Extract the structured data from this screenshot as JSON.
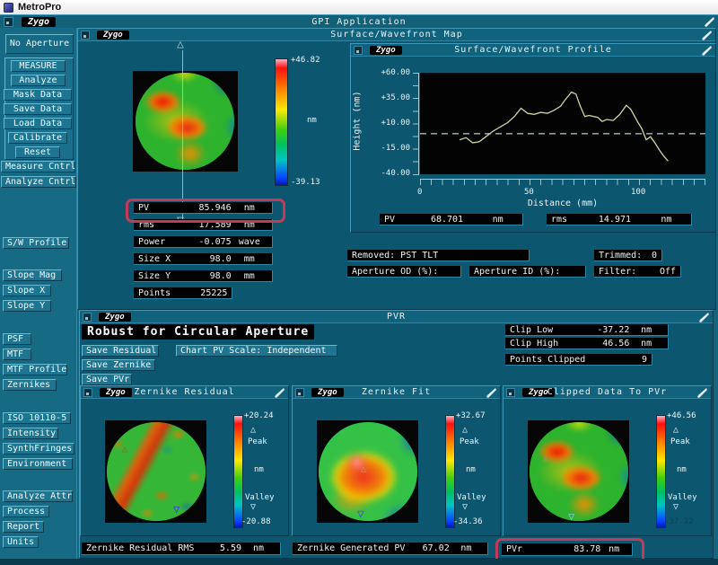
{
  "brand": "Zygo",
  "window": {
    "title": "MetroPro"
  },
  "app_bar": {
    "title": "GPI Application"
  },
  "sidebar": {
    "aperture_label": "No Aperture",
    "measure_group": [
      "MEASURE",
      "Analyze",
      "Mask Data",
      "Save Data",
      "Load Data",
      "Calibrate",
      "Reset"
    ],
    "cntrl": [
      "Measure Cntrl",
      "Analyze Cntrl"
    ],
    "profile": "S/W Profile",
    "slope": [
      "Slope Mag",
      "Slope X",
      "Slope Y"
    ],
    "optics": [
      "PSF",
      "MTF",
      "MTF Profile",
      "Zernikes"
    ],
    "iso": [
      "ISO 10110-5",
      "Intensity",
      "SynthFringes",
      "Environment"
    ],
    "misc": [
      "Analyze Attr",
      "Process",
      "Report",
      "Units"
    ]
  },
  "map_panel": {
    "title": "Surface/Wavefront Map",
    "colorbar": {
      "max": "+46.82",
      "unit": "nm",
      "min": "-39.13"
    },
    "stats": [
      {
        "label": "PV",
        "value": "85.946",
        "unit": "nm"
      },
      {
        "label": "rms",
        "value": "17.589",
        "unit": "nm"
      },
      {
        "label": "Power",
        "value": "-0.075",
        "unit": "wave"
      },
      {
        "label": "Size X",
        "value": "98.0",
        "unit": "mm"
      },
      {
        "label": "Size Y",
        "value": "98.0",
        "unit": "mm"
      },
      {
        "label": "Points",
        "value": "25225",
        "unit": ""
      }
    ]
  },
  "profile_panel": {
    "title": "Surface/Wavefront Profile",
    "ylabel": "Height (nm)",
    "xlabel": "Distance (mm)",
    "yticks": [
      "+60.00",
      "+35.00",
      "+10.00",
      "-15.00",
      "-40.00"
    ],
    "xticks": [
      "0",
      "50",
      "100"
    ],
    "stats": [
      {
        "label": "PV",
        "value": "68.701",
        "unit": "nm"
      },
      {
        "label": "rms",
        "value": "14.971",
        "unit": "nm"
      }
    ]
  },
  "attributes": {
    "removed": "Removed: PST TLT",
    "trimmed_label": "Trimmed:",
    "trimmed_value": "0",
    "aperture_od": "Aperture OD (%):",
    "aperture_id": "Aperture ID (%):",
    "filter_label": "Filter:",
    "filter_value": "Off"
  },
  "pvr_panel": {
    "title": "PVR",
    "heading": "Robust for Circular Aperture",
    "save_residual": "Save Residual",
    "chart_scale": "Chart PV Scale: Independent",
    "save_zernike": "Save Zernike",
    "save_pvr": "Save PVr",
    "clip_stats": [
      {
        "label": "Clip Low",
        "value": "-37.22",
        "unit": "nm"
      },
      {
        "label": "Clip High",
        "value": "46.56",
        "unit": "nm"
      },
      {
        "label": "Points Clipped",
        "value": "9",
        "unit": ""
      }
    ],
    "subpanels": [
      {
        "title": "Zernike Residual",
        "max": "+20.24",
        "min": "-20.88",
        "unit": "nm",
        "peak_label": "Peak",
        "valley_label": "Valley"
      },
      {
        "title": "Zernike Fit",
        "max": "+32.67",
        "min": "-34.36",
        "unit": "nm",
        "peak_label": "Peak",
        "valley_label": "Valley"
      },
      {
        "title": "Clipped Data To PVr",
        "max": "+46.56",
        "min": "-37.22",
        "unit": "nm",
        "peak_label": "Peak",
        "valley_label": "Valley"
      }
    ],
    "results": [
      {
        "label": "Zernike Residual RMS",
        "value": "5.59",
        "unit": "nm"
      },
      {
        "label": "Zernike Generated PV",
        "value": "67.02",
        "unit": "nm"
      },
      {
        "label": "PVr",
        "value": "83.78",
        "unit": "nm"
      }
    ]
  },
  "icons": {
    "peak_marker": "△",
    "valley_marker": "▽",
    "arrow_up": "△",
    "arrow_down": "▽"
  },
  "colors": {
    "highlight_red": "#c43b57",
    "profile_line": "#ccd8a4",
    "panel_teal": "#0d566f"
  },
  "chart_data": {
    "type": "line",
    "title": "Surface/Wavefront Profile",
    "xlabel": "Distance (mm)",
    "ylabel": "Height (nm)",
    "xlim": [
      0,
      130
    ],
    "ylim": [
      -40,
      60
    ],
    "yticks": [
      60,
      35,
      10,
      -15,
      -40
    ],
    "xticks": [
      0,
      50,
      100
    ],
    "zero_line": 0,
    "points": [
      [
        18,
        -6
      ],
      [
        21,
        -4
      ],
      [
        24,
        -9
      ],
      [
        27,
        -8
      ],
      [
        30,
        -3
      ],
      [
        33,
        2
      ],
      [
        36,
        6
      ],
      [
        40,
        11
      ],
      [
        43,
        17
      ],
      [
        46,
        25
      ],
      [
        49,
        20
      ],
      [
        52,
        19
      ],
      [
        55,
        21
      ],
      [
        58,
        20
      ],
      [
        61,
        23
      ],
      [
        64,
        27
      ],
      [
        66,
        33
      ],
      [
        69,
        41
      ],
      [
        71,
        39
      ],
      [
        73,
        27
      ],
      [
        75,
        17
      ],
      [
        77,
        18
      ],
      [
        79,
        17
      ],
      [
        81,
        16
      ],
      [
        83,
        12
      ],
      [
        85,
        14
      ],
      [
        88,
        13
      ],
      [
        91,
        19
      ],
      [
        94,
        28
      ],
      [
        96,
        24
      ],
      [
        99,
        12
      ],
      [
        101,
        5
      ],
      [
        103,
        -6
      ],
      [
        105,
        -3
      ],
      [
        107,
        -9
      ],
      [
        109,
        -16
      ],
      [
        111,
        -22
      ],
      [
        113,
        -27
      ]
    ]
  }
}
